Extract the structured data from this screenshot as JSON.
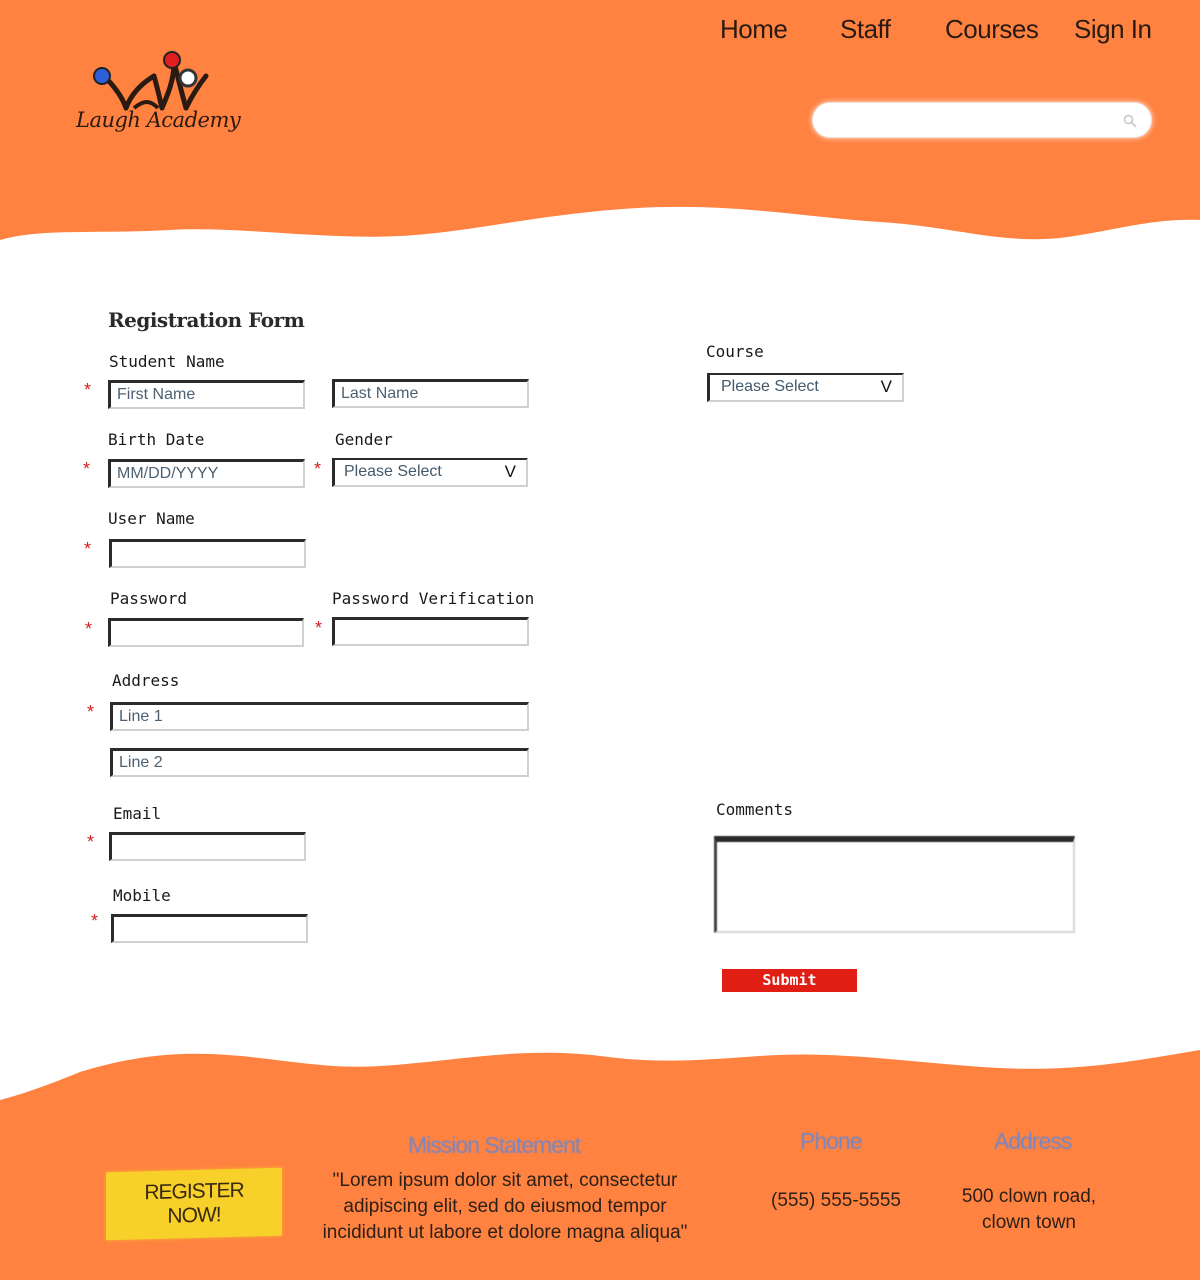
{
  "brand": {
    "name": "Laugh Academy"
  },
  "colors": {
    "header_bg": "#ff8240",
    "accent": "#e01e14",
    "register_bg": "#f7d02a",
    "footer_heading": "#6f86c8"
  },
  "nav": {
    "items": [
      "Home",
      "Staff",
      "Courses",
      "Sign In"
    ]
  },
  "search": {
    "placeholder": ""
  },
  "form": {
    "title": "Registration Form",
    "required_marker": "*",
    "student_name": {
      "label": "Student Name",
      "first_placeholder": "First Name",
      "last_placeholder": "Last Name"
    },
    "birth_date": {
      "label": "Birth Date",
      "placeholder": "MM/DD/YYYY"
    },
    "gender": {
      "label": "Gender",
      "value": "Please Select",
      "caret": "V"
    },
    "user_name": {
      "label": "User Name"
    },
    "password": {
      "label": "Password"
    },
    "password_verification": {
      "label": "Password Verification"
    },
    "address": {
      "label": "Address",
      "line1_placeholder": "Line 1",
      "line2_placeholder": "Line 2"
    },
    "email": {
      "label": "Email"
    },
    "mobile": {
      "label": "Mobile"
    },
    "course": {
      "label": "Course",
      "value": "Please Select",
      "caret": "V"
    },
    "comments": {
      "label": "Comments"
    },
    "submit_label": "Submit"
  },
  "footer": {
    "register_label": "REGISTER\nNOW!",
    "mission": {
      "heading": "Mission Statement",
      "text": "\"Lorem ipsum dolor sit amet, consectetur\nadipiscing elit, sed do eiusmod tempor\nincididunt ut labore et dolore magna aliqua\""
    },
    "phone": {
      "heading": "Phone",
      "text": "(555) 555-5555"
    },
    "address": {
      "heading": "Address",
      "text": "500 clown road,\nclown town"
    }
  }
}
